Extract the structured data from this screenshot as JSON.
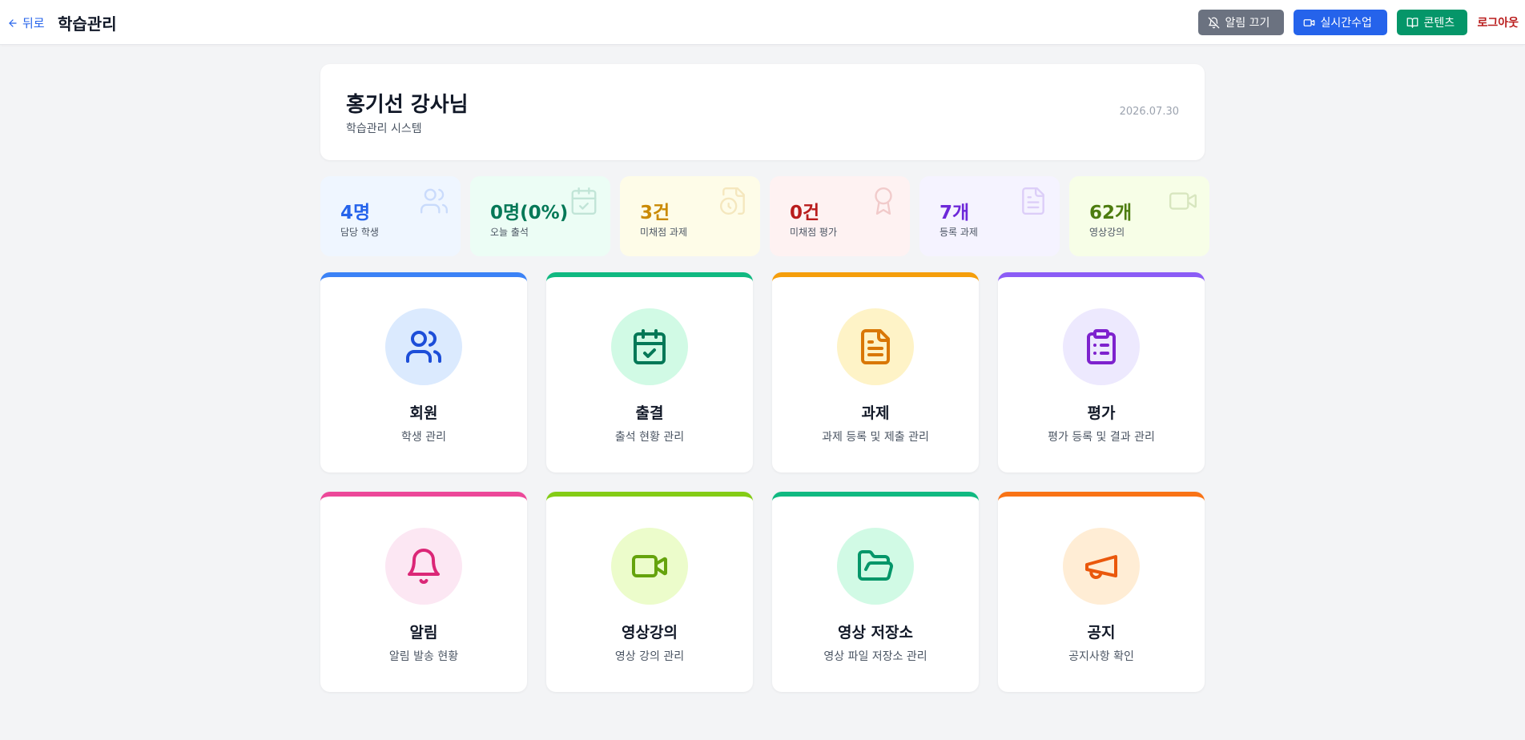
{
  "topbar": {
    "back_label": "뒤로",
    "title": "학습관리",
    "buttons": {
      "notify_off": "알림 끄기",
      "live_class": "실시간수업",
      "content": "콘텐츠",
      "logout": "로그아웃"
    }
  },
  "header": {
    "name": "홍기선 강사님",
    "subtitle": "학습관리 시스템",
    "date": "2026.07.30"
  },
  "stats": [
    {
      "value": "4명",
      "label": "담당 학생",
      "icon": "users-icon",
      "bg": "#eff6ff",
      "color": "#2563eb"
    },
    {
      "value": "0명(0%)",
      "label": "오늘 출석",
      "icon": "calendar-check-icon",
      "bg": "#ecfdf5",
      "color": "#047857"
    },
    {
      "value": "3건",
      "label": "미채점 과제",
      "icon": "file-clock-icon",
      "bg": "#fefce8",
      "color": "#ca8a04"
    },
    {
      "value": "0건",
      "label": "미채점 평가",
      "icon": "award-icon",
      "bg": "#fef2f2",
      "color": "#b91c1c"
    },
    {
      "value": "7개",
      "label": "등록 과제",
      "icon": "file-text-icon",
      "bg": "#f5f3ff",
      "color": "#6d28d9"
    },
    {
      "value": "62개",
      "label": "영상강의",
      "icon": "video-icon",
      "bg": "#f7fee7",
      "color": "#4d7c0f"
    }
  ],
  "cards": [
    {
      "title": "회원",
      "desc": "학생 관리",
      "icon": "users-icon",
      "accent": "#3b82f6",
      "icon_bg": "#dbeafe",
      "icon_color": "#1d4ed8"
    },
    {
      "title": "출결",
      "desc": "출석 현황 관리",
      "icon": "calendar-check-icon",
      "accent": "#10b981",
      "icon_bg": "#d1fae5",
      "icon_color": "#047857"
    },
    {
      "title": "과제",
      "desc": "과제 등록 및 제출 관리",
      "icon": "file-text-icon",
      "accent": "#f59e0b",
      "icon_bg": "#fef3c7",
      "icon_color": "#d97706"
    },
    {
      "title": "평가",
      "desc": "평가 등록 및 결과 관리",
      "icon": "clipboard-list-icon",
      "accent": "#8b5cf6",
      "icon_bg": "#ede9fe",
      "icon_color": "#7e22ce"
    },
    {
      "title": "알림",
      "desc": "알림 발송 현황",
      "icon": "bell-icon",
      "accent": "#ec4899",
      "icon_bg": "#fce7f3",
      "icon_color": "#db2777"
    },
    {
      "title": "영상강의",
      "desc": "영상 강의 관리",
      "icon": "video-icon",
      "accent": "#84cc16",
      "icon_bg": "#ecfccb",
      "icon_color": "#65a30d"
    },
    {
      "title": "영상 저장소",
      "desc": "영상 파일 저장소 관리",
      "icon": "folder-open-icon",
      "accent": "#10b981",
      "icon_bg": "#d1fae5",
      "icon_color": "#059669"
    },
    {
      "title": "공지",
      "desc": "공지사항 확인",
      "icon": "megaphone-icon",
      "accent": "#f97316",
      "icon_bg": "#ffedd5",
      "icon_color": "#ea580c"
    }
  ]
}
